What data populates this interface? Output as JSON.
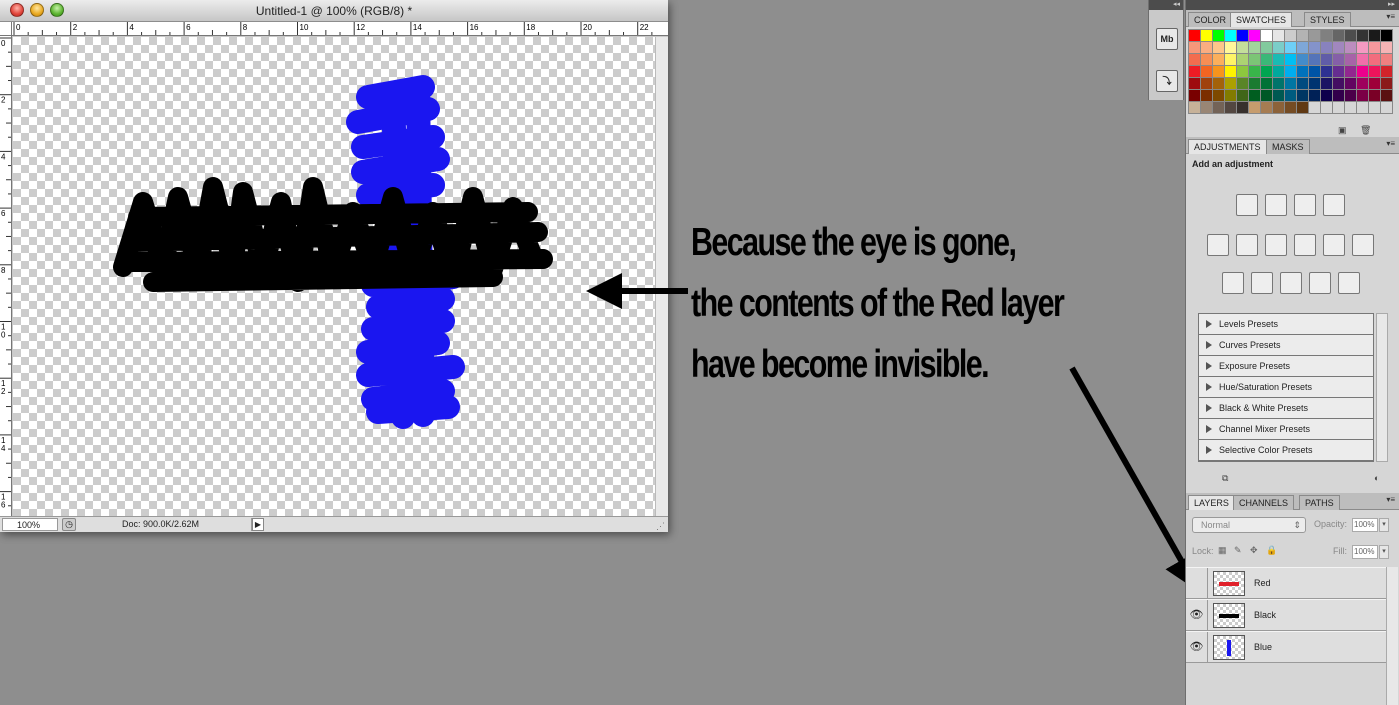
{
  "document": {
    "title": "Untitled-1 @ 100% (RGB/8) *",
    "zoom": "100%",
    "doc_size": "Doc: 900.0K/2.62M",
    "ruler_h_labels": [
      "0",
      "2",
      "4",
      "6",
      "8",
      "10",
      "12",
      "14",
      "16",
      "18",
      "20",
      "22"
    ],
    "ruler_v_labels": [
      "0",
      "2",
      "4",
      "6",
      "8",
      "10",
      "12",
      "14",
      "16"
    ],
    "stroke_colors": {
      "black": "#000000",
      "blue": "#1a16f0"
    }
  },
  "annotation": {
    "lines": [
      "Because the eye is gone,",
      "the contents of the Red layer",
      "have become invisible."
    ]
  },
  "dock": {
    "icons": [
      "mini-bridge-icon",
      "history-icon"
    ],
    "mini_bridge_text": "Mb"
  },
  "swatches_panel": {
    "tabs": [
      "COLOR",
      "SWATCHES",
      "STYLES"
    ],
    "active_tab": "SWATCHES",
    "colors": [
      "#ff0000",
      "#ffff00",
      "#00ff00",
      "#00ffff",
      "#0000ff",
      "#ff00ff",
      "#ffffff",
      "#e6e6e6",
      "#cccccc",
      "#b3b3b3",
      "#999999",
      "#808080",
      "#666666",
      "#4d4d4d",
      "#333333",
      "#1a1a1a",
      "#000000",
      "#f7977a",
      "#f9ad81",
      "#fdc68a",
      "#fff79a",
      "#c4df9b",
      "#a2d39c",
      "#82ca9d",
      "#7bcdc8",
      "#6ecff6",
      "#7ea7d8",
      "#8493ca",
      "#8882be",
      "#a187be",
      "#bc8dbf",
      "#f49ac2",
      "#f6989d",
      "#f5b4b5",
      "#f26c4f",
      "#f68e55",
      "#fbaf5c",
      "#fff467",
      "#acd372",
      "#7cc576",
      "#3bb878",
      "#1abbb4",
      "#00bff3",
      "#438cca",
      "#5574b9",
      "#605ca8",
      "#855fa8",
      "#a763a8",
      "#f06eaa",
      "#f26d7d",
      "#f08080",
      "#ed1c24",
      "#f26522",
      "#f7941d",
      "#fff200",
      "#8dc73f",
      "#39b54a",
      "#00a651",
      "#00a99d",
      "#00aeef",
      "#0072bc",
      "#0054a6",
      "#2e3192",
      "#662d91",
      "#92278f",
      "#ec008c",
      "#ed145b",
      "#d2232a",
      "#9e0b0f",
      "#a0410d",
      "#a3620a",
      "#aba000",
      "#598527",
      "#1a7b30",
      "#007236",
      "#00746b",
      "#0076a3",
      "#004b80",
      "#003471",
      "#1b1464",
      "#440e62",
      "#630460",
      "#9e005d",
      "#9e0039",
      "#8b1a1a",
      "#790000",
      "#7b2e00",
      "#7d4900",
      "#827b00",
      "#406618",
      "#005e20",
      "#005826",
      "#005952",
      "#005b7f",
      "#003663",
      "#002157",
      "#0d004c",
      "#32004b",
      "#4b0049",
      "#7b0046",
      "#7a0026",
      "#5a1010",
      "#c7b299",
      "#998675",
      "#736357",
      "#534741",
      "#37302d",
      "#c69c6d",
      "#a67c52",
      "#8c6239",
      "#754c24",
      "#603913",
      "#d6d6d6",
      "#d6d6d6",
      "#d6d6d6",
      "#d6d6d6",
      "#d6d6d6",
      "#d6d6d6",
      "#d6d6d6"
    ]
  },
  "adjustments_panel": {
    "tabs": [
      "ADJUSTMENTS",
      "MASKS"
    ],
    "active_tab": "ADJUSTMENTS",
    "hint": "Add an adjustment",
    "presets": [
      "Levels Presets",
      "Curves Presets",
      "Exposure Presets",
      "Hue/Saturation Presets",
      "Black & White Presets",
      "Channel Mixer Presets",
      "Selective Color Presets"
    ]
  },
  "layers_panel": {
    "tabs": [
      "LAYERS",
      "CHANNELS",
      "PATHS"
    ],
    "active_tab": "LAYERS",
    "blend_mode": "Normal",
    "opacity_label": "Opacity:",
    "opacity": "100%",
    "lock_label": "Lock:",
    "fill_label": "Fill:",
    "fill": "100%",
    "layers": [
      {
        "name": "Red",
        "visible": false,
        "thumb_color": "#e0202a"
      },
      {
        "name": "Black",
        "visible": true,
        "thumb_color": "#000000"
      },
      {
        "name": "Blue",
        "visible": true,
        "thumb_color": "#1a16f0"
      }
    ]
  }
}
